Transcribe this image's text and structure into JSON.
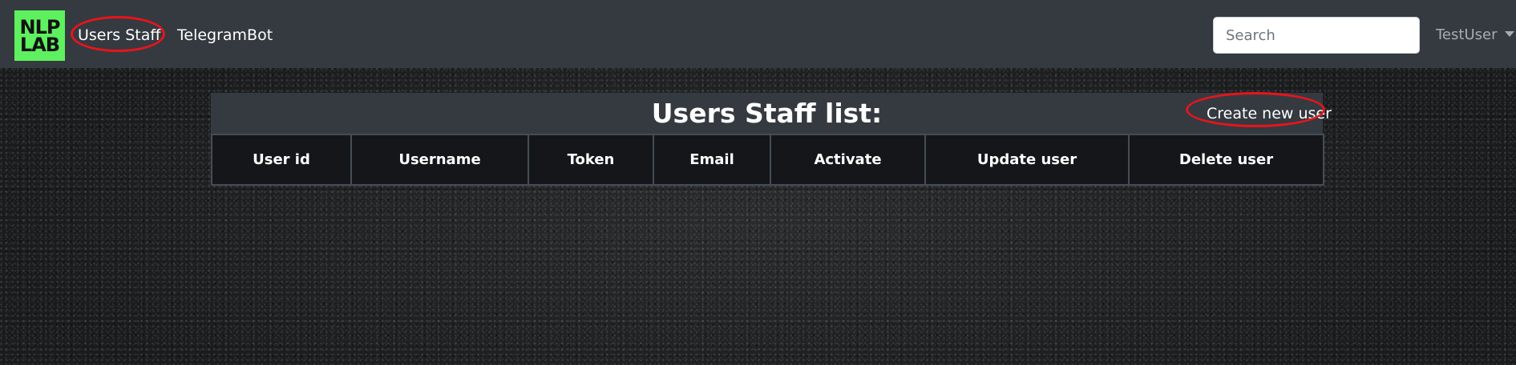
{
  "navbar": {
    "logo_lines": [
      "NLP",
      "LAB"
    ],
    "links": [
      {
        "label": "Users Staff"
      },
      {
        "label": "TelegramBot"
      }
    ],
    "search_placeholder": "Search",
    "user": "TestUser"
  },
  "panel": {
    "title": "Users Staff list:",
    "create_button": "Create new user",
    "columns": [
      "User id",
      "Username",
      "Token",
      "Email",
      "Activate",
      "Update user",
      "Delete user"
    ],
    "rows": []
  },
  "colors": {
    "navbar": "#343a40",
    "logo": "#5ef05e",
    "highlight": "#e8141c",
    "table_header": "#141619"
  }
}
